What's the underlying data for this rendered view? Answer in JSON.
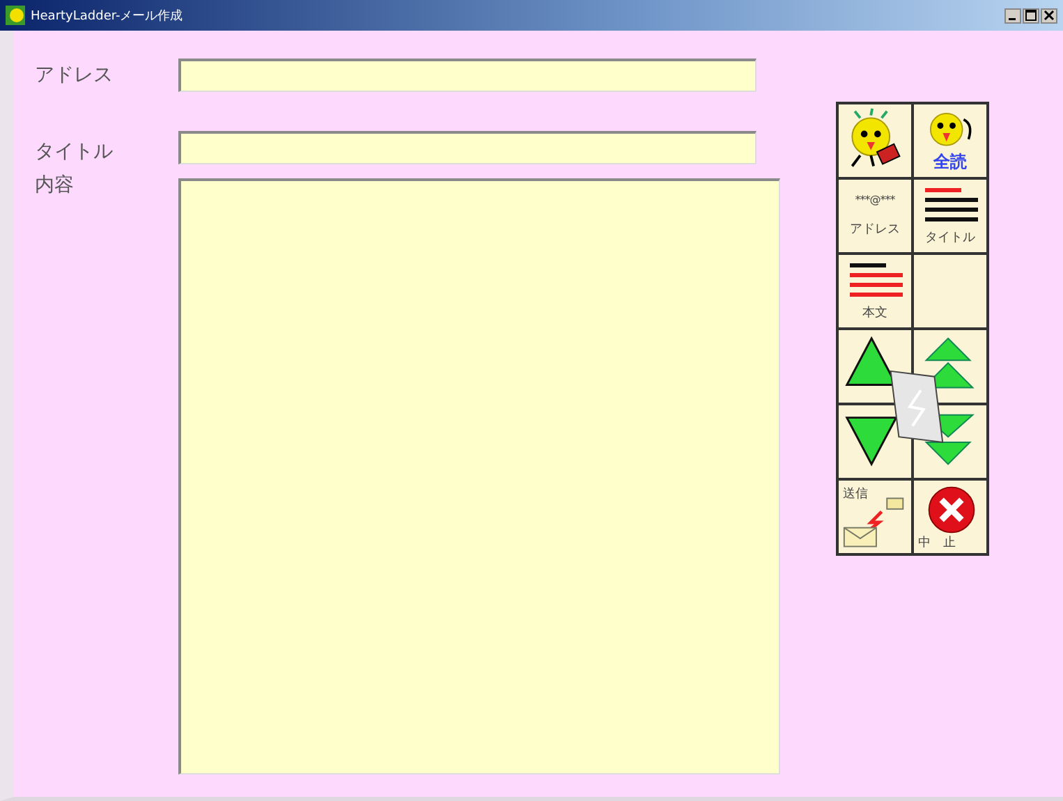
{
  "window": {
    "title": "HeartyLadder-メール作成"
  },
  "form": {
    "fields": [
      {
        "label": "アドレス",
        "kind": "line"
      },
      {
        "label": "タイトル",
        "kind": "line"
      },
      {
        "label": "内容",
        "kind": "area"
      }
    ]
  },
  "toolbar": {
    "buttons": [
      {
        "kind": "bird-read"
      },
      {
        "kind": "bird-all",
        "label": "全読"
      },
      {
        "kind": "address",
        "code": "***@***",
        "label": "アドレス"
      },
      {
        "kind": "title",
        "label": "タイトル"
      },
      {
        "kind": "body",
        "label": "本文"
      },
      {
        "kind": "blank"
      },
      {
        "kind": "scroll"
      },
      {
        "kind": "send",
        "label": "送信"
      },
      {
        "kind": "cancel",
        "label": "中　止"
      }
    ]
  }
}
